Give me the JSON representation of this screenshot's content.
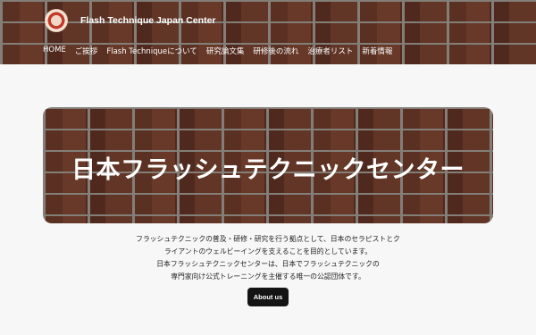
{
  "header": {
    "site_title": "Flash Technique Japan Center",
    "logo_icon": "center-seal-logo"
  },
  "nav": {
    "items": [
      {
        "label": "HOME"
      },
      {
        "label": "ご挨拶"
      },
      {
        "label": "Flash Techniqueについて"
      },
      {
        "label": "研究論文集"
      },
      {
        "label": "研修後の流れ"
      },
      {
        "label": "治療者リスト"
      },
      {
        "label": "新着情報"
      }
    ]
  },
  "hero": {
    "title": "日本フラッシュテクニックセンター"
  },
  "intro": {
    "lines": [
      "フラッシュテクニックの普及・研修・研究を行う拠点として、日本のセラピストとク",
      "ライアントのウェルビーイングを支えることを目的としています。",
      "日本フラッシュテクニックセンターは、日本でフラッシュテクニックの",
      "専門家向け公式トレーニングを主催する唯一の公認団体です。"
    ]
  },
  "cta": {
    "about_label": "About us"
  },
  "colors": {
    "page_bg": "#f7f7f7",
    "button_bg": "#141414",
    "header_text": "#ffffff"
  }
}
